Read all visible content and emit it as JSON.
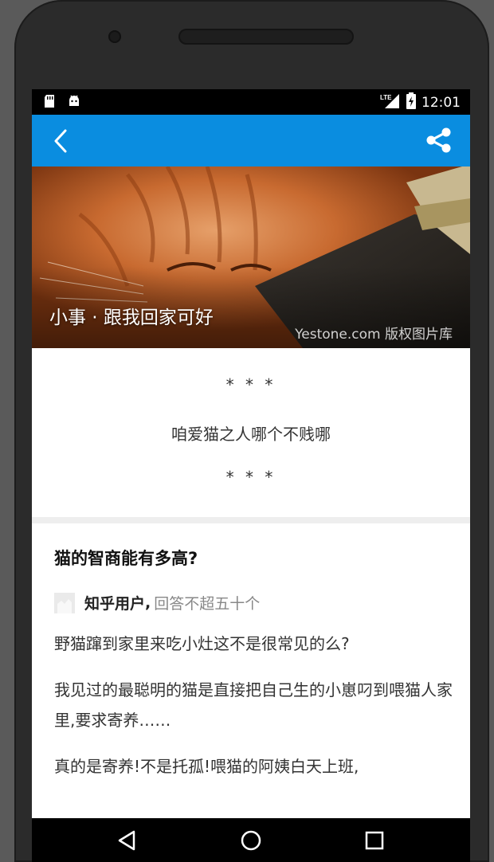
{
  "status_bar": {
    "time": "12:01",
    "network": "LTE",
    "icons": [
      "sd-card-icon",
      "android-icon",
      "lte-signal-icon",
      "battery-charging-icon"
    ]
  },
  "app_bar": {
    "color": "#0a8de0",
    "back_icon": "chevron-left-icon",
    "share_icon": "share-icon"
  },
  "hero": {
    "title": "小事 · 跟我回家可好",
    "credit": "Yestone.com 版权图片库"
  },
  "intro": {
    "stars_top": "* * *",
    "text": "咱爱猫之人哪个不贱哪",
    "stars_bottom": "* * *"
  },
  "answer": {
    "question": "猫的智商能有多高?",
    "author_name": "知乎用户",
    "author_sep": ",",
    "author_desc": "回答不超五十个",
    "paragraphs": [
      "野猫蹿到家里来吃小灶这不是很常见的么?",
      "我见过的最聪明的猫是直接把自己生的小崽叼到喂猫人家里,要求寄养……",
      "真的是寄养!不是托孤!喂猫的阿姨白天上班,"
    ]
  },
  "nav_bar": {
    "buttons": [
      "back-triangle-icon",
      "home-circle-icon",
      "recents-square-icon"
    ]
  }
}
